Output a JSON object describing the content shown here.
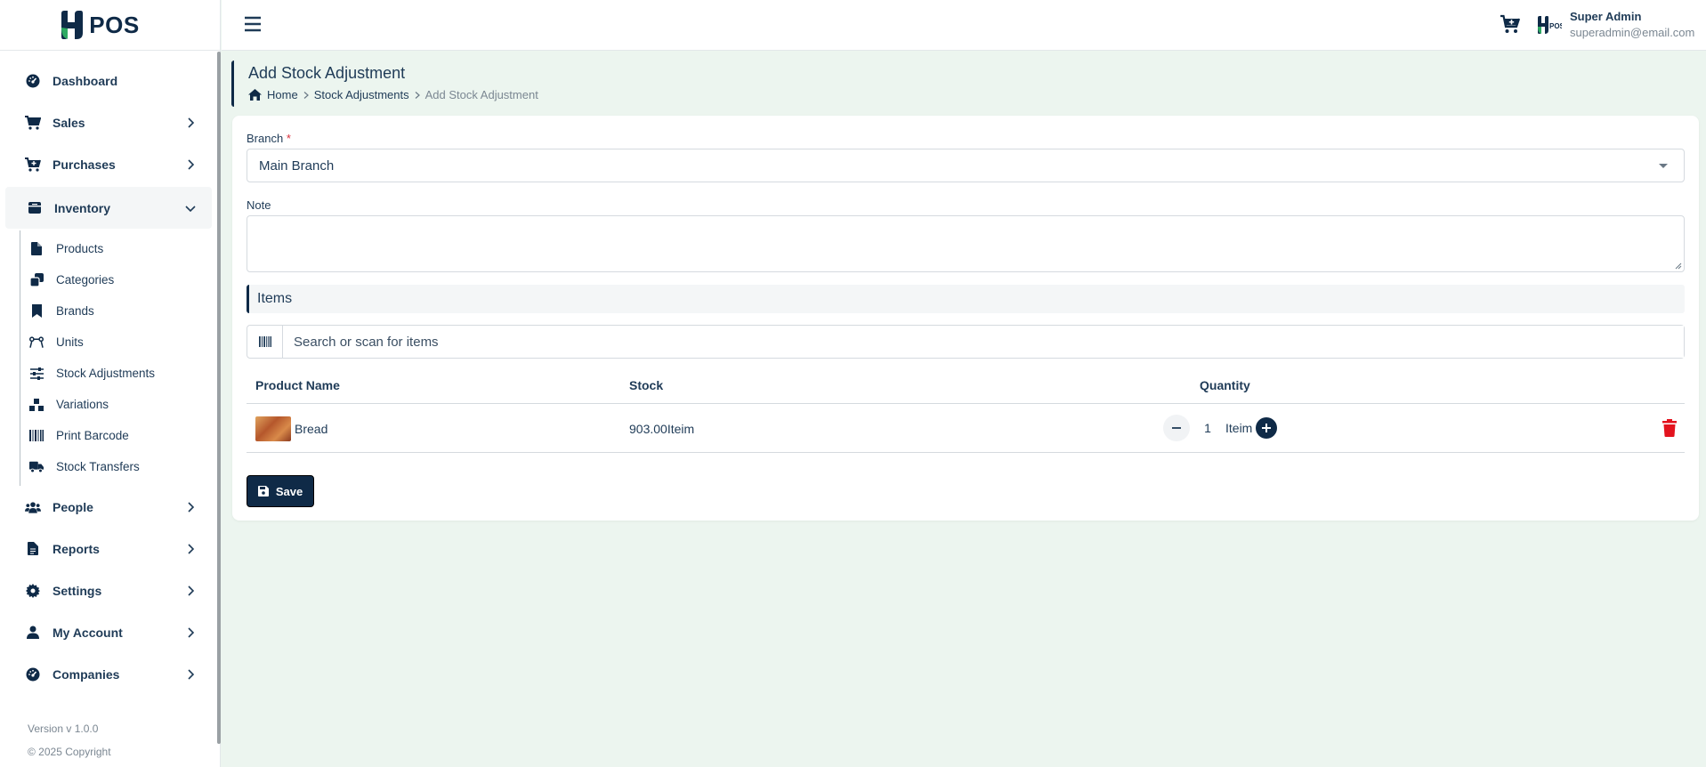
{
  "brand": {
    "logo_text": "POS"
  },
  "sidebar": {
    "items": [
      {
        "label": "Dashboard",
        "icon": "dashboard-icon"
      },
      {
        "label": "Sales",
        "icon": "cart-icon"
      },
      {
        "label": "Purchases",
        "icon": "cart-plus-icon"
      },
      {
        "label": "Inventory",
        "icon": "box-icon"
      },
      {
        "label": "People",
        "icon": "users-icon"
      },
      {
        "label": "Reports",
        "icon": "report-icon"
      },
      {
        "label": "Settings",
        "icon": "gear-icon"
      },
      {
        "label": "My Account",
        "icon": "user-icon"
      },
      {
        "label": "Companies",
        "icon": "companies-icon"
      }
    ],
    "inventory_sub": [
      {
        "label": "Products",
        "icon": "file-icon"
      },
      {
        "label": "Categories",
        "icon": "copy-icon"
      },
      {
        "label": "Brands",
        "icon": "bookmark-icon"
      },
      {
        "label": "Units",
        "icon": "ruler-icon"
      },
      {
        "label": "Stock Adjustments",
        "icon": "sliders-icon"
      },
      {
        "label": "Variations",
        "icon": "cubes-icon"
      },
      {
        "label": "Print Barcode",
        "icon": "barcode-icon"
      },
      {
        "label": "Stock Transfers",
        "icon": "truck-icon"
      }
    ],
    "version": "Version v 1.0.0",
    "copyright": "© 2025 Copyright"
  },
  "header": {
    "user_name": "Super Admin",
    "user_email": "superadmin@email.com"
  },
  "page": {
    "title": "Add Stock Adjustment",
    "breadcrumb": [
      "Home",
      "Stock Adjustments",
      "Add Stock Adjustment"
    ]
  },
  "form": {
    "branch_label": "Branch",
    "branch_required": "*",
    "branch_value": "Main Branch",
    "note_label": "Note",
    "note_value": "",
    "items_heading": "Items",
    "search_placeholder": "Search or scan for items",
    "save_label": "Save"
  },
  "table": {
    "columns": [
      "Product Name",
      "Stock",
      "Quantity"
    ],
    "rows": [
      {
        "name": "Bread",
        "stock": "903.00Iteim",
        "quantity": "1",
        "unit": "Iteim"
      }
    ]
  },
  "colors": {
    "primary": "#0f2a47",
    "background": "#ecf5ef",
    "danger": "#e3131e"
  }
}
